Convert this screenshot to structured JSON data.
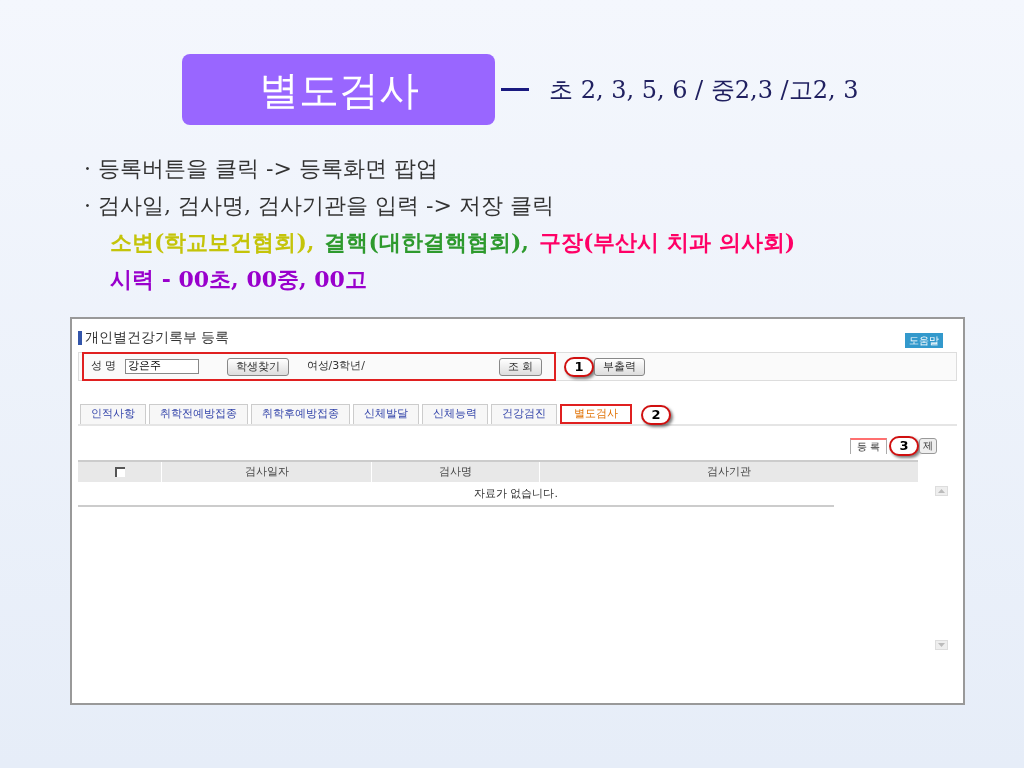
{
  "slide": {
    "title": "별도검사",
    "subtitle": "초 2, 3, 5, 6 / 중2,3 /고2, 3",
    "bullets": [
      "· 등록버튼을 클릭 -> 등록화면 팝업",
      "· 검사일, 검사명, 검사기관을 입력 -> 저장 클릭"
    ],
    "notes": [
      [
        {
          "text": "소변(학교보건협회),",
          "color": "#c4c40a"
        },
        {
          "text": "결핵(대한결핵협회),",
          "color": "#2e9a2e"
        },
        {
          "text": "구장(부산시 치과 의사회)",
          "color": "#ff0066"
        }
      ],
      [
        {
          "text": "시력 - 00초, 00중, 00고",
          "color": "#9900cc"
        }
      ]
    ]
  },
  "screen": {
    "title": "개인별건강기록부 등록",
    "help_button": "도움말",
    "search": {
      "label": "성 명",
      "value": "강은주",
      "find_button": "학생찾기",
      "info": "여성/3학년/",
      "query_button": "조 회",
      "print_button": "부출력"
    },
    "tabs": [
      {
        "label": "인적사항",
        "selected": false
      },
      {
        "label": "취학전예방접종",
        "selected": false
      },
      {
        "label": "취학후예방접종",
        "selected": false
      },
      {
        "label": "신체발달",
        "selected": false
      },
      {
        "label": "신체능력",
        "selected": false
      },
      {
        "label": "건강검진",
        "selected": false
      },
      {
        "label": "별도검사",
        "selected": true
      }
    ],
    "actions": [
      "등 록",
      "제"
    ],
    "table": {
      "select_all": {
        "checked": false
      },
      "columns": [
        "검사일자",
        "검사명",
        "검사기관"
      ],
      "empty_message": "자료가 없습니다."
    },
    "callouts": [
      "1",
      "2",
      "3"
    ]
  }
}
